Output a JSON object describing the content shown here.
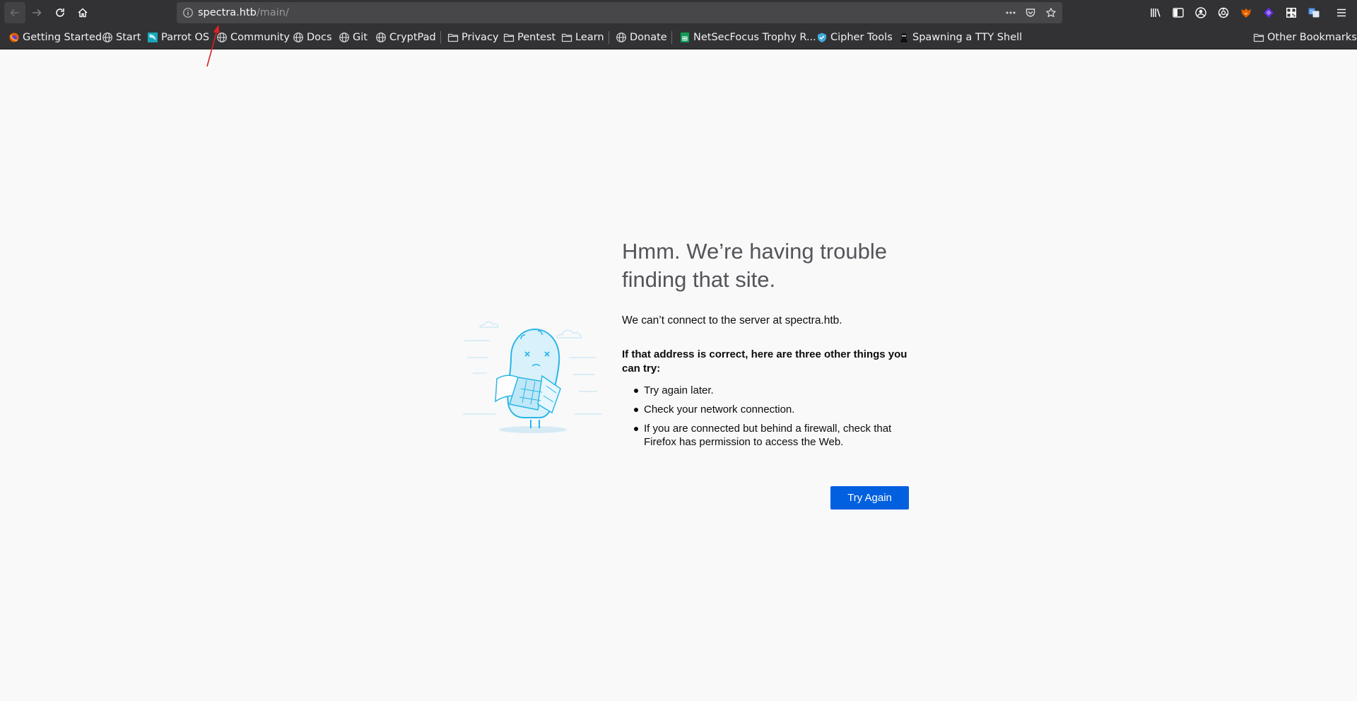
{
  "browser": {
    "url_host": "spectra.htb",
    "url_path": "/main/"
  },
  "icons": {
    "nav": [
      "back-icon",
      "forward-icon",
      "reload-icon",
      "home-icon"
    ],
    "url_actions": [
      "more-actions-icon",
      "pocket-icon",
      "star-icon"
    ],
    "toolbar": [
      "library-icon",
      "sidebar-icon",
      "account-icon",
      "extensions-gear-icon",
      "foxyproxy-icon",
      "extension-icon",
      "qr-icon",
      "translate-icon",
      "menu-icon"
    ]
  },
  "bookmarks": [
    {
      "label": "Getting Started",
      "icon": "firefox-icon"
    },
    {
      "label": "Start",
      "icon": "globe-icon"
    },
    {
      "label": "Parrot OS",
      "icon": "parrot-icon"
    },
    {
      "label": "Community",
      "icon": "globe-icon"
    },
    {
      "label": "Docs",
      "icon": "globe-icon"
    },
    {
      "label": "Git",
      "icon": "globe-icon"
    },
    {
      "label": "CryptPad",
      "icon": "globe-icon"
    },
    {
      "label": "Privacy",
      "icon": "folder-icon"
    },
    {
      "label": "Pentest",
      "icon": "folder-icon"
    },
    {
      "label": "Learn",
      "icon": "folder-icon"
    },
    {
      "label": "Donate",
      "icon": "globe-icon"
    },
    {
      "label": "NetSecFocus Trophy R...",
      "icon": "sheets-icon"
    },
    {
      "label": "Cipher Tools",
      "icon": "cipher-icon"
    },
    {
      "label": "Spawning a TTY Shell",
      "icon": "ninja-icon"
    }
  ],
  "other_bookmarks": "Other Bookmarks",
  "error": {
    "title": "Hmm. We’re having trouble finding that site.",
    "description": "We can’t connect to the server at spectra.htb.",
    "tips_heading": "If that address is correct, here are three other things you can try:",
    "tips": [
      "Try again later.",
      "Check your network connection.",
      "If you are connected but behind a firewall, check that Firefox has permission to access the Web."
    ],
    "button_label": "Try Again"
  },
  "colors": {
    "toolbar_bg": "#323234",
    "urlbar_bg": "#474749",
    "page_bg": "#f9f9fa",
    "button_blue": "#0060df",
    "illustration_blue": "#2ab6e8",
    "annotation_red": "#e02020"
  }
}
